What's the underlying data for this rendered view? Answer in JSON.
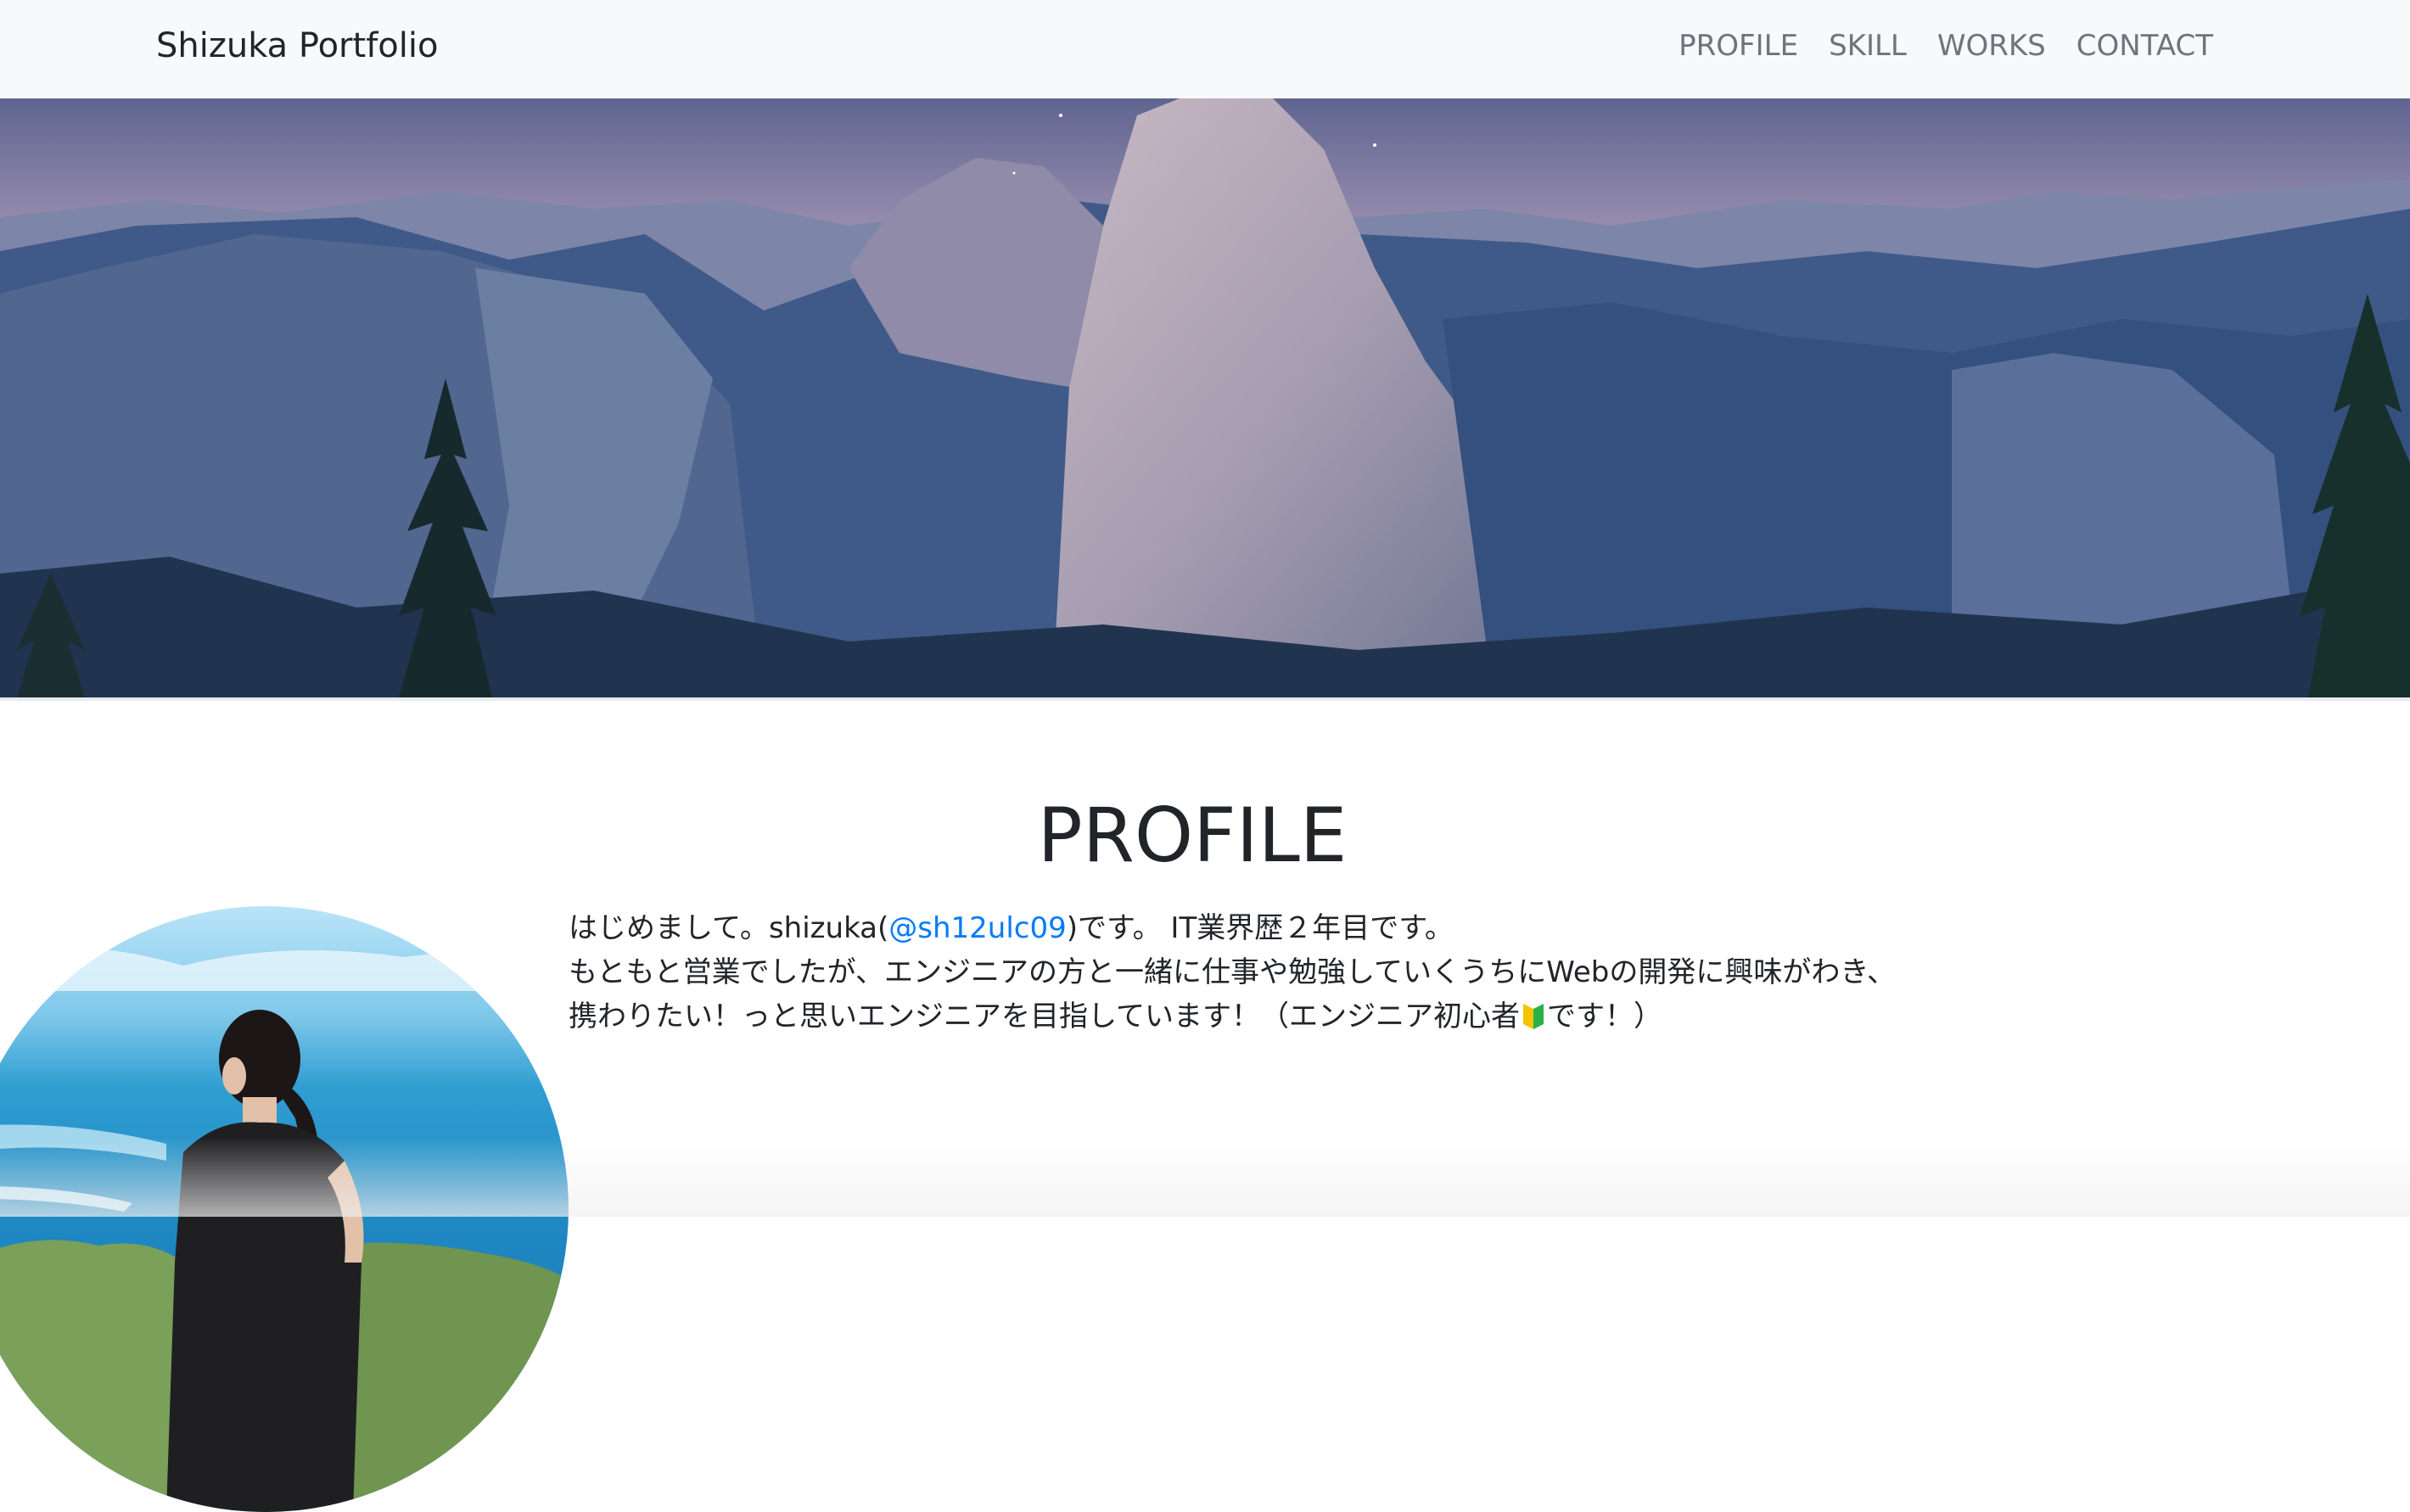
{
  "navbar": {
    "brand": "Shizuka Portfolio",
    "links": [
      "PROFILE",
      "SKILL",
      "WORKS",
      "CONTACT"
    ]
  },
  "hero": {
    "image": "mountain-valley-landscape"
  },
  "profile": {
    "title": "PROFILE",
    "avatar": "person-by-ocean-photo",
    "line1_before": "はじめまして。shizuka(",
    "twitter_handle": "@sh12ulc09",
    "line1_after": ")です。 IT業界歴２年目です。",
    "line2": "もともと営業でしたが、エンジニアの方と一緒に仕事や勉強していくうちにWebの開発に興味がわき、",
    "line3_before": "携わりたい！っと思いエンジニアを目指しています！（エンジニア初心者",
    "line3_icon": "beginner-mark-icon",
    "line3_after": "です！）"
  },
  "colors": {
    "navbar_bg": "#f8f9fa",
    "nav_link": "#6c757d",
    "link": "#007bff",
    "text": "#212529"
  }
}
